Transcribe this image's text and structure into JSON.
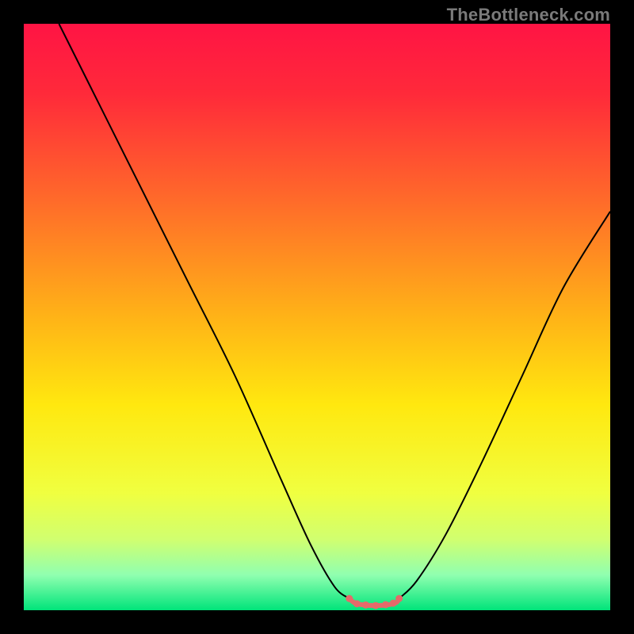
{
  "watermark": {
    "text": "TheBottleneck.com"
  },
  "colors": {
    "black": "#000000",
    "curve": "#000000",
    "connector": "#e56a6a",
    "green": "#00e47a"
  },
  "chart_data": {
    "type": "line",
    "title": "",
    "xlabel": "",
    "ylabel": "",
    "x_range": [
      0,
      100
    ],
    "y_range": [
      0,
      100
    ],
    "grid": false,
    "legend": false,
    "gradient_stops": [
      {
        "pos": 0.0,
        "color": "#ff1444"
      },
      {
        "pos": 0.12,
        "color": "#ff2a3a"
      },
      {
        "pos": 0.3,
        "color": "#ff6a2a"
      },
      {
        "pos": 0.5,
        "color": "#ffb317"
      },
      {
        "pos": 0.65,
        "color": "#ffe80f"
      },
      {
        "pos": 0.8,
        "color": "#f0ff40"
      },
      {
        "pos": 0.88,
        "color": "#d0ff70"
      },
      {
        "pos": 0.94,
        "color": "#90ffb0"
      },
      {
        "pos": 1.0,
        "color": "#00e47a"
      }
    ],
    "series": [
      {
        "name": "left-curve",
        "x": [
          6,
          12,
          20,
          28,
          36,
          44,
          49,
          53,
          55.5
        ],
        "y": [
          100,
          88,
          72,
          56,
          40,
          22,
          11,
          4,
          2
        ]
      },
      {
        "name": "right-curve",
        "x": [
          64,
          67,
          72,
          78,
          85,
          92,
          100
        ],
        "y": [
          2,
          5,
          13,
          25,
          40,
          55,
          68
        ]
      },
      {
        "name": "bottom-connector",
        "x": [
          55.5,
          56.5,
          58,
          60,
          62,
          63.5,
          64
        ],
        "y": [
          2,
          1.2,
          0.9,
          0.8,
          0.9,
          1.3,
          2
        ]
      }
    ],
    "markers": [
      {
        "x": 55.5,
        "y": 2
      },
      {
        "x": 56.8,
        "y": 1.1
      },
      {
        "x": 58.3,
        "y": 0.9
      },
      {
        "x": 60.0,
        "y": 0.8
      },
      {
        "x": 61.7,
        "y": 0.95
      },
      {
        "x": 63.0,
        "y": 1.2
      },
      {
        "x": 64.0,
        "y": 2
      }
    ]
  }
}
